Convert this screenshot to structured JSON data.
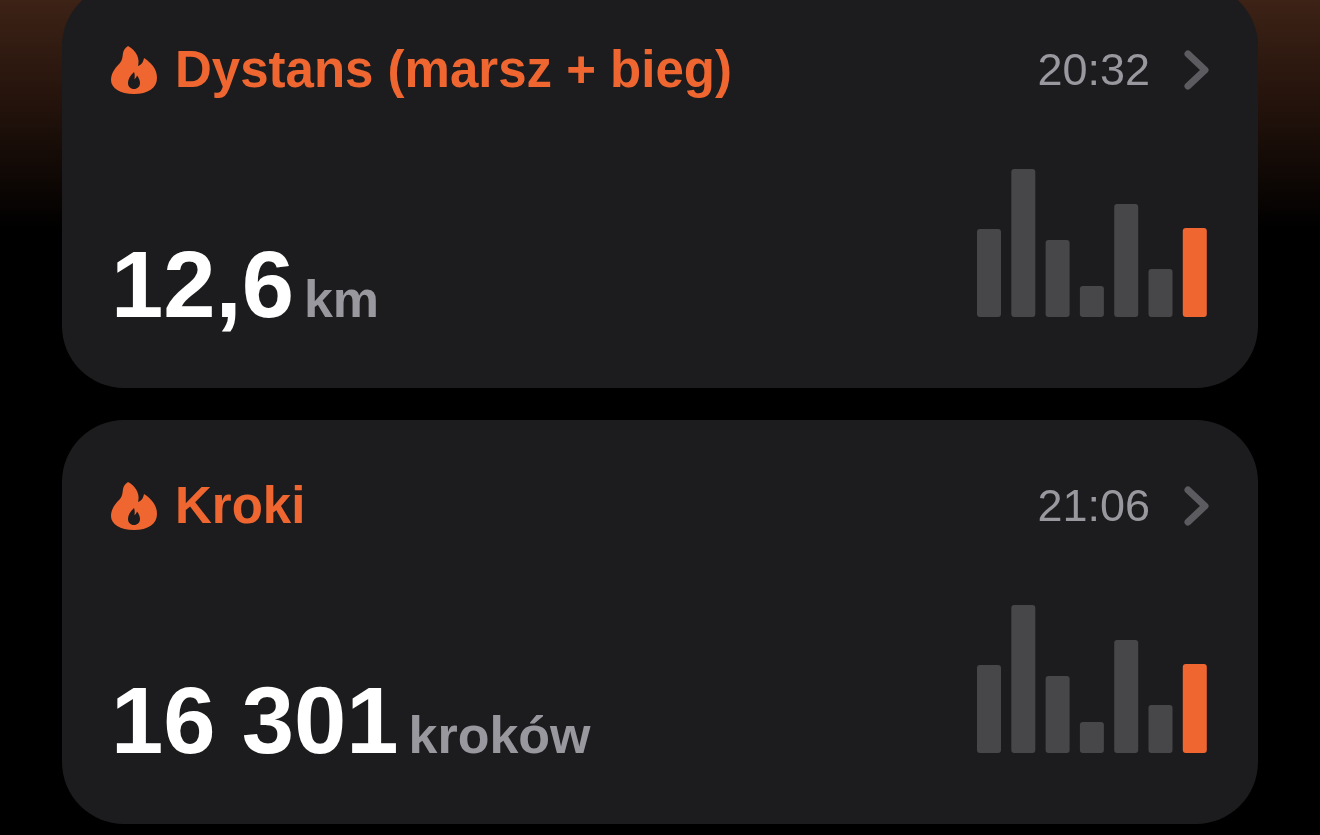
{
  "cards": [
    {
      "title": "Dystans (marsz + bieg)",
      "time": "20:32",
      "value": "12,6",
      "unit": "km"
    },
    {
      "title": "Kroki",
      "time": "21:06",
      "value": "16 301",
      "unit": "kroków"
    }
  ]
}
